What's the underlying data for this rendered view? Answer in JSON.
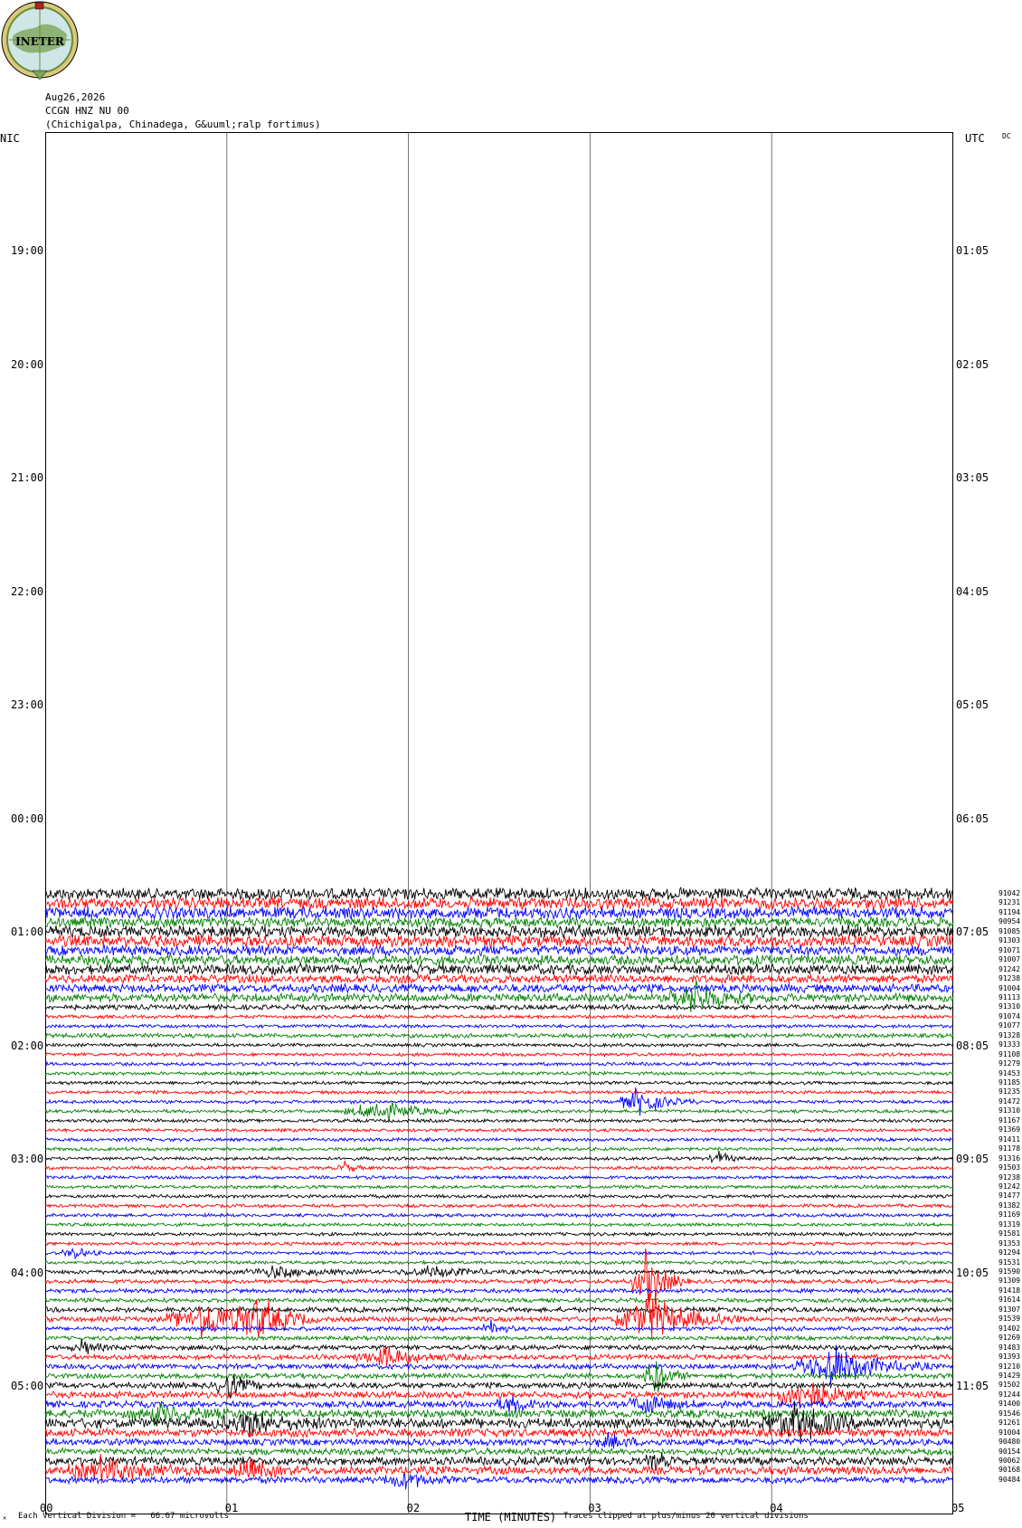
{
  "header": {
    "logo_text": "INETER",
    "date": "Aug26,2026",
    "station": "CCGN HNZ NU 00",
    "location": "(Chichigalpa, Chinadega, G&uuml;ralp fortimus)",
    "left_zone": "NIC",
    "right_zone": "UTC",
    "dc_label": "DC"
  },
  "footer": {
    "vertical_division": "Each Vertical Division =",
    "microvolts": "66.67 microvolts",
    "time_label": "TIME (MINUTES)",
    "clip_note": "Traces clipped at plus/minus 20 vertical divisions"
  },
  "chart_data": {
    "type": "line",
    "title": "",
    "xlabel": "TIME (MINUTES)",
    "x_ticks": [
      "00",
      "01",
      "02",
      "03",
      "04",
      "05"
    ],
    "xlim": [
      0,
      5
    ],
    "left_time_labels": [
      "19:00",
      "20:00",
      "21:00",
      "22:00",
      "23:00",
      "00:00",
      "01:00",
      "02:00",
      "03:00",
      "04:00",
      "05:00"
    ],
    "right_time_labels": [
      "01:05",
      "02:05",
      "03:05",
      "04:05",
      "05:05",
      "06:05",
      "07:05",
      "08:05",
      "09:05",
      "10:05",
      "11:05"
    ],
    "trace_colors": [
      "#000000",
      "#ff0000",
      "#0000ff",
      "#008000"
    ],
    "dc_offsets": [
      "91042",
      "91231",
      "91194",
      "90954",
      "91085",
      "91303",
      "91071",
      "91007",
      "91242",
      "91238",
      "91004",
      "91113",
      "91310",
      "91074",
      "91077",
      "91328",
      "91333",
      "91108",
      "91279",
      "91453",
      "91185",
      "91235",
      "91472",
      "91310",
      "91167",
      "91369",
      "91411",
      "91178",
      "91316",
      "91503",
      "91238",
      "91242",
      "91477",
      "91382",
      "91169",
      "91319",
      "91581",
      "91353",
      "91294",
      "91531",
      "91590",
      "91309",
      "91418",
      "91614",
      "91307",
      "91539",
      "91402",
      "91269",
      "91483",
      "91393",
      "91210",
      "91429",
      "91502",
      "91244",
      "91400",
      "91546",
      "91261",
      "91004",
      "90480",
      "90154",
      "90062",
      "90168",
      "90484"
    ],
    "trace_activity": [
      {
        "trace": 0,
        "bg": 7,
        "events": []
      },
      {
        "trace": 1,
        "bg": 7,
        "events": []
      },
      {
        "trace": 2,
        "bg": 7,
        "events": []
      },
      {
        "trace": 3,
        "bg": 6,
        "events": []
      },
      {
        "trace": 4,
        "bg": 7,
        "events": []
      },
      {
        "trace": 5,
        "bg": 7,
        "events": []
      },
      {
        "trace": 6,
        "bg": 6,
        "events": []
      },
      {
        "trace": 7,
        "bg": 6,
        "events": []
      },
      {
        "trace": 8,
        "bg": 6,
        "events": []
      },
      {
        "trace": 9,
        "bg": 5,
        "events": []
      },
      {
        "trace": 10,
        "bg": 5,
        "events": []
      },
      {
        "trace": 11,
        "bg": 5,
        "events": [
          {
            "t": 3.55,
            "w": 0.4,
            "amp": 22
          }
        ]
      },
      {
        "trace": 12,
        "bg": 3,
        "events": []
      },
      {
        "trace": 13,
        "bg": 2,
        "events": []
      },
      {
        "trace": 14,
        "bg": 2,
        "events": []
      },
      {
        "trace": 15,
        "bg": 2.5,
        "events": []
      },
      {
        "trace": 16,
        "bg": 2,
        "events": []
      },
      {
        "trace": 17,
        "bg": 2,
        "events": []
      },
      {
        "trace": 18,
        "bg": 2,
        "events": []
      },
      {
        "trace": 19,
        "bg": 2,
        "events": []
      },
      {
        "trace": 20,
        "bg": 2,
        "events": []
      },
      {
        "trace": 21,
        "bg": 2,
        "events": []
      },
      {
        "trace": 22,
        "bg": 2,
        "events": [
          {
            "t": 3.25,
            "w": 0.35,
            "amp": 18
          }
        ]
      },
      {
        "trace": 23,
        "bg": 2,
        "events": [
          {
            "t": 1.8,
            "w": 0.5,
            "amp": 16
          }
        ]
      },
      {
        "trace": 24,
        "bg": 2,
        "events": []
      },
      {
        "trace": 25,
        "bg": 2,
        "events": []
      },
      {
        "trace": 26,
        "bg": 2,
        "events": []
      },
      {
        "trace": 27,
        "bg": 2,
        "events": []
      },
      {
        "trace": 28,
        "bg": 2,
        "events": [
          {
            "t": 3.7,
            "w": 0.15,
            "amp": 10
          }
        ]
      },
      {
        "trace": 29,
        "bg": 2,
        "events": [
          {
            "t": 1.65,
            "w": 0.12,
            "amp": 8
          }
        ]
      },
      {
        "trace": 30,
        "bg": 2,
        "events": []
      },
      {
        "trace": 31,
        "bg": 2,
        "events": []
      },
      {
        "trace": 32,
        "bg": 2,
        "events": []
      },
      {
        "trace": 33,
        "bg": 2,
        "events": []
      },
      {
        "trace": 34,
        "bg": 2,
        "events": []
      },
      {
        "trace": 35,
        "bg": 2,
        "events": []
      },
      {
        "trace": 36,
        "bg": 2,
        "events": []
      },
      {
        "trace": 37,
        "bg": 2,
        "events": []
      },
      {
        "trace": 38,
        "bg": 2,
        "events": [
          {
            "t": 0.15,
            "w": 0.2,
            "amp": 7
          }
        ]
      },
      {
        "trace": 39,
        "bg": 2,
        "events": []
      },
      {
        "trace": 40,
        "bg": 2.5,
        "events": [
          {
            "t": 1.25,
            "w": 0.5,
            "amp": 8
          },
          {
            "t": 2.1,
            "w": 0.5,
            "amp": 7
          }
        ]
      },
      {
        "trace": 41,
        "bg": 2.5,
        "events": [
          {
            "t": 3.3,
            "w": 0.25,
            "amp": 40
          }
        ]
      },
      {
        "trace": 42,
        "bg": 2.5,
        "events": []
      },
      {
        "trace": 43,
        "bg": 2.5,
        "events": []
      },
      {
        "trace": 44,
        "bg": 3,
        "events": []
      },
      {
        "trace": 45,
        "bg": 3,
        "events": [
          {
            "t": 0.85,
            "w": 0.6,
            "amp": 25
          },
          {
            "t": 1.15,
            "w": 0.35,
            "amp": 30
          },
          {
            "t": 3.3,
            "w": 0.55,
            "amp": 35
          }
        ]
      },
      {
        "trace": 46,
        "bg": 2.5,
        "events": [
          {
            "t": 2.45,
            "w": 0.15,
            "amp": 10
          }
        ]
      },
      {
        "trace": 47,
        "bg": 2.5,
        "events": []
      },
      {
        "trace": 48,
        "bg": 3,
        "events": [
          {
            "t": 0.2,
            "w": 0.2,
            "amp": 8
          }
        ]
      },
      {
        "trace": 49,
        "bg": 3,
        "events": [
          {
            "t": 1.85,
            "w": 0.5,
            "amp": 14
          }
        ]
      },
      {
        "trace": 50,
        "bg": 3,
        "events": [
          {
            "t": 4.3,
            "w": 0.6,
            "amp": 28
          }
        ]
      },
      {
        "trace": 51,
        "bg": 3,
        "events": [
          {
            "t": 3.35,
            "w": 0.2,
            "amp": 26
          }
        ]
      },
      {
        "trace": 52,
        "bg": 3.5,
        "events": [
          {
            "t": 1.0,
            "w": 0.2,
            "amp": 20
          }
        ]
      },
      {
        "trace": 53,
        "bg": 4,
        "events": [
          {
            "t": 4.15,
            "w": 0.4,
            "amp": 30
          }
        ]
      },
      {
        "trace": 54,
        "bg": 4,
        "events": [
          {
            "t": 3.3,
            "w": 0.3,
            "amp": 14
          },
          {
            "t": 2.55,
            "w": 0.3,
            "amp": 10
          }
        ]
      },
      {
        "trace": 55,
        "bg": 5,
        "events": [
          {
            "t": 0.6,
            "w": 0.5,
            "amp": 10
          }
        ]
      },
      {
        "trace": 56,
        "bg": 6,
        "events": [
          {
            "t": 4.1,
            "w": 0.5,
            "amp": 25
          },
          {
            "t": 1.1,
            "w": 0.6,
            "amp": 12
          }
        ]
      },
      {
        "trace": 57,
        "bg": 5,
        "events": []
      },
      {
        "trace": 58,
        "bg": 4,
        "events": [
          {
            "t": 3.1,
            "w": 0.3,
            "amp": 8
          }
        ]
      },
      {
        "trace": 59,
        "bg": 4,
        "events": []
      },
      {
        "trace": 60,
        "bg": 5,
        "events": [
          {
            "t": 3.35,
            "w": 0.15,
            "amp": 12
          }
        ]
      },
      {
        "trace": 61,
        "bg": 5,
        "events": [
          {
            "t": 0.3,
            "w": 0.6,
            "amp": 14
          },
          {
            "t": 1.1,
            "w": 0.3,
            "amp": 14
          }
        ]
      },
      {
        "trace": 62,
        "bg": 4,
        "events": [
          {
            "t": 1.95,
            "w": 0.3,
            "amp": 12
          }
        ]
      }
    ]
  }
}
